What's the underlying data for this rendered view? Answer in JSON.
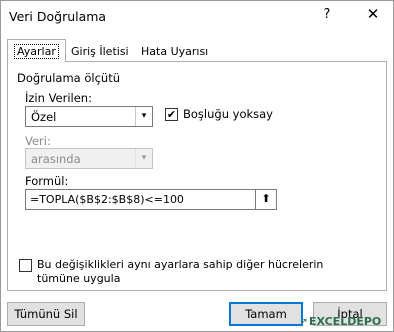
{
  "window": {
    "title": "Veri Doğrulama",
    "help_symbol": "?",
    "close_symbol": "✕"
  },
  "tabs": [
    {
      "label": "Ayarlar"
    },
    {
      "label": "Giriş İletisi"
    },
    {
      "label": "Hata Uyarısı"
    }
  ],
  "settings": {
    "group_title": "Doğrulama ölçütü",
    "allow_label": "İzin Verilen:",
    "allow_value": "Özel",
    "ignore_blank_label": "Boşluğu yoksay",
    "ignore_blank_checked": true,
    "data_label": "Veri:",
    "data_value": "arasında",
    "formula_label": "Formül:",
    "formula_value": "=TOPLA($B$2:$B$8)<=100",
    "apply_all_label": "Bu değişiklikleri aynı ayarlara sahip diğer hücrelerin tümüne uygula",
    "apply_all_checked": false
  },
  "buttons": {
    "clear_all": "Tümünü Sil",
    "ok": "Tamam",
    "cancel": "İptal"
  },
  "watermark": {
    "text": "EXCELDEPO"
  },
  "icons": {
    "dropdown": "▾",
    "check": "✔",
    "collapse_ref": "⬆"
  }
}
